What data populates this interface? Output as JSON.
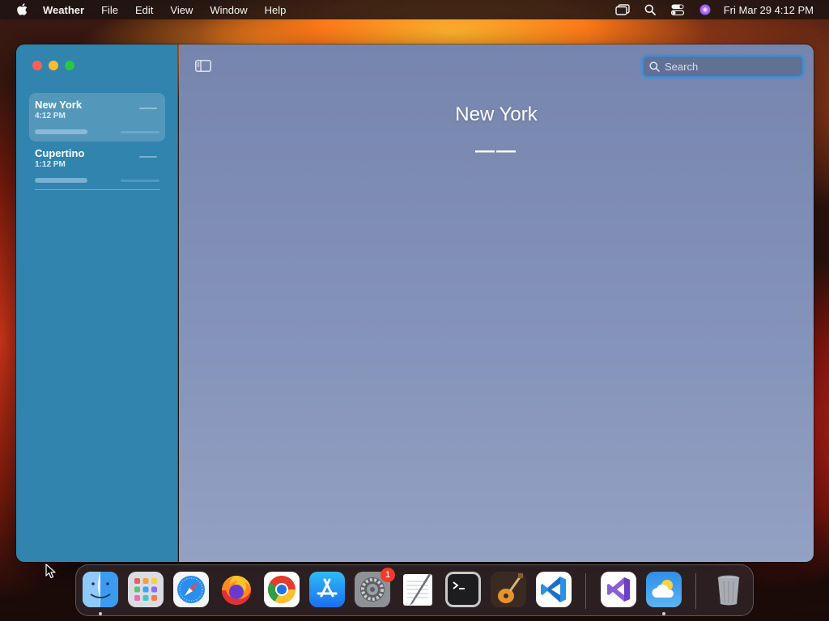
{
  "menubar": {
    "app_name": "Weather",
    "menus": [
      "File",
      "Edit",
      "View",
      "Window",
      "Help"
    ],
    "clock": "Fri Mar 29  4:12 PM"
  },
  "sidebar": {
    "locations": [
      {
        "name": "New York",
        "time": "4:12 PM"
      },
      {
        "name": "Cupertino",
        "time": "1:12 PM"
      }
    ]
  },
  "main": {
    "search_placeholder": "Search",
    "city": "New York",
    "temperature": "——"
  },
  "dock": {
    "items": [
      "finder-icon",
      "launchpad-icon",
      "safari-icon",
      "firefox-icon",
      "chrome-icon",
      "app-store-icon",
      "system-settings-icon",
      "textedit-icon",
      "terminal-icon",
      "garageband-icon",
      "vscode-icon",
      "visual-studio-icon",
      "weather-icon",
      "trash-icon"
    ],
    "settings_badge": "1"
  },
  "colors": {
    "sidebar": "#3184ad",
    "main_top": "#7685ad",
    "search_focus": "#3a8fd8"
  }
}
